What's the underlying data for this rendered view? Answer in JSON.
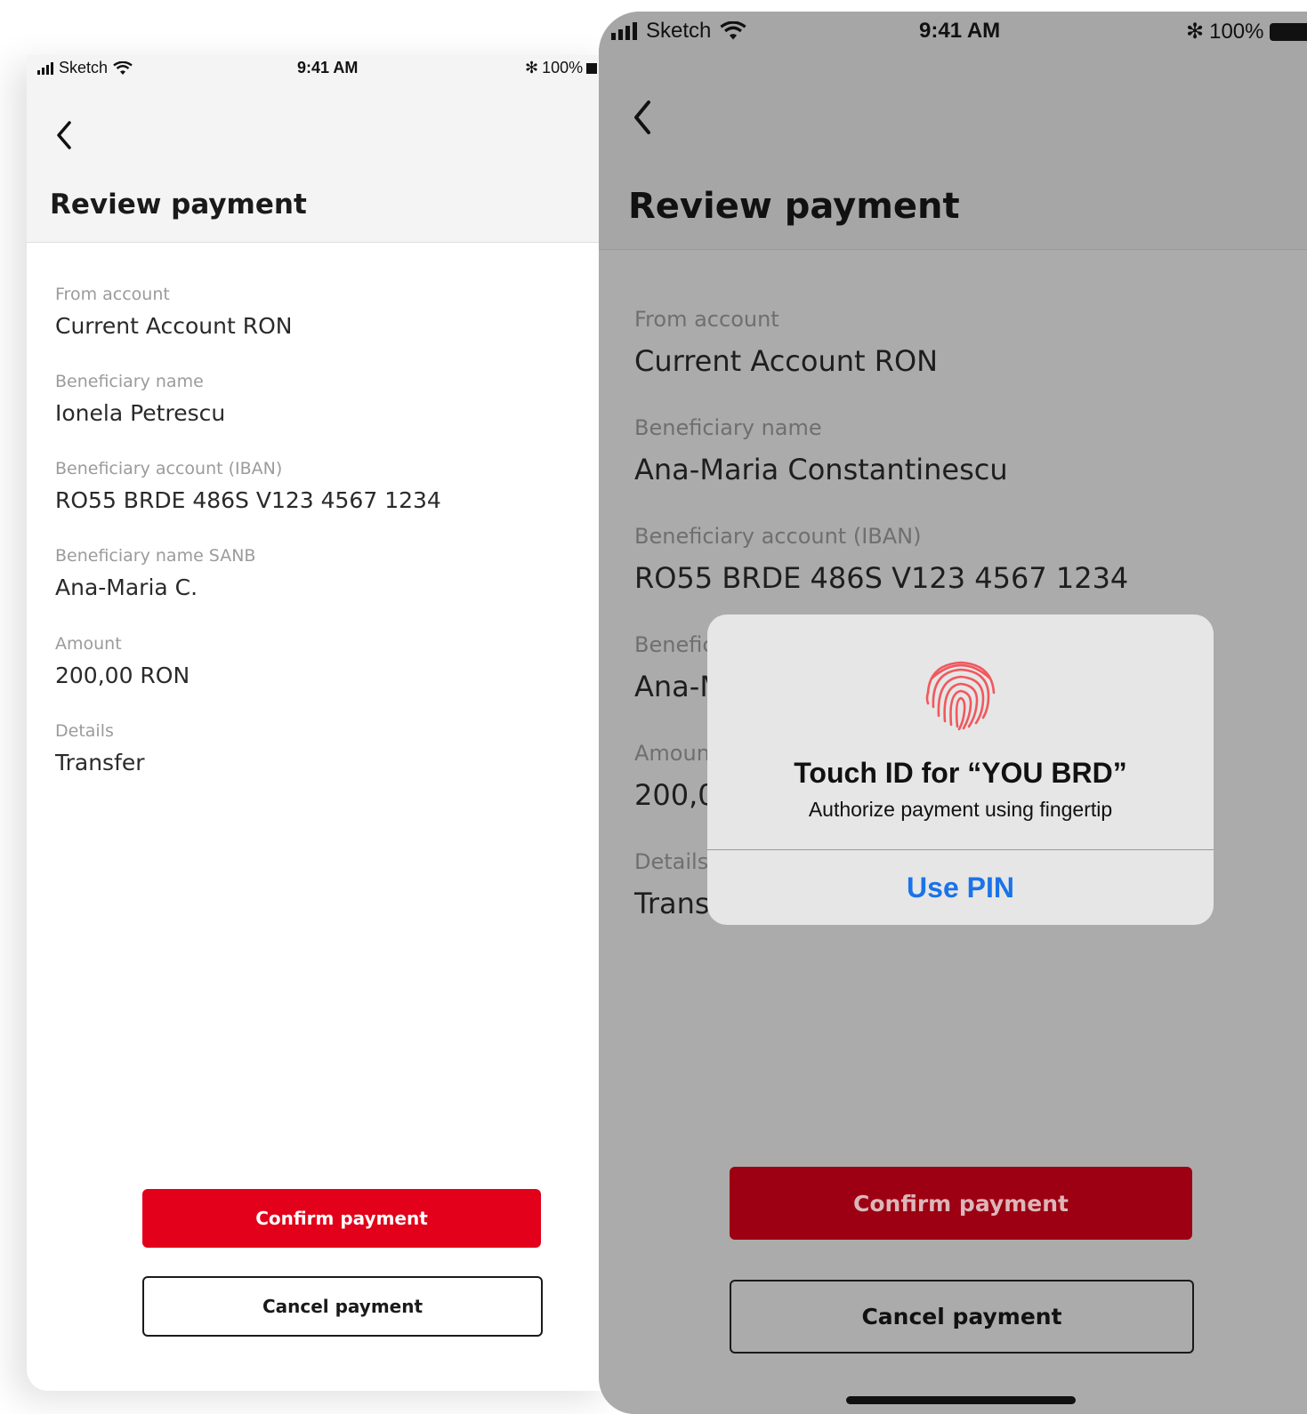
{
  "status_bar": {
    "carrier": "Sketch",
    "time": "9:41 AM",
    "battery": "100%"
  },
  "left_screen": {
    "title": "Review payment",
    "fields": [
      {
        "label": "From account",
        "value": "Current Account RON"
      },
      {
        "label": "Beneficiary name",
        "value": "Ionela Petrescu"
      },
      {
        "label": "Beneficiary account (IBAN)",
        "value": "RO55 BRDE 486S V123 4567 1234"
      },
      {
        "label": "Beneficiary name SANB",
        "value": "Ana-Maria C."
      },
      {
        "label": "Amount",
        "value": "200,00 RON"
      },
      {
        "label": "Details",
        "value": "Transfer"
      }
    ],
    "confirm_label": "Confirm payment",
    "cancel_label": "Cancel payment"
  },
  "right_screen": {
    "title": "Review payment",
    "fields": [
      {
        "label": "From account",
        "value": "Current Account RON"
      },
      {
        "label": "Beneficiary name",
        "value": "Ana-Maria Constantinescu"
      },
      {
        "label": "Beneficiary account (IBAN)",
        "value": "RO55 BRDE 486S V123 4567 1234"
      },
      {
        "label": "Benefic",
        "value": "Ana-M"
      },
      {
        "label": "Amoun",
        "value": "200,0"
      },
      {
        "label": "Details",
        "value": "Trans."
      }
    ],
    "confirm_label": "Confirm payment",
    "cancel_label": "Cancel payment"
  },
  "touch_id_dialog": {
    "title": "Touch ID for “YOU BRD”",
    "subtitle": "Authorize payment using fingertip",
    "button_label": "Use PIN",
    "icon": "fingerprint-icon",
    "accent_color": "#1a73e8",
    "icon_color": "#f0585e"
  },
  "colors": {
    "brand_red": "#e2001a",
    "brand_red_dimmed": "#9c0012"
  }
}
